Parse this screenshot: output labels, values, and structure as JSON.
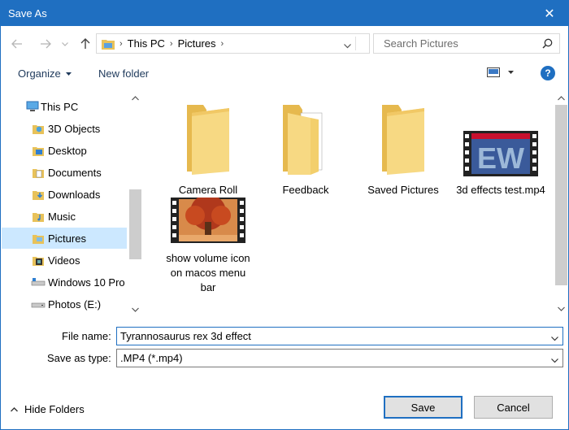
{
  "window": {
    "title": "Save As",
    "close_glyph": "✕"
  },
  "address": {
    "crumbs": [
      "This PC",
      "Pictures"
    ],
    "search_placeholder": "Search Pictures"
  },
  "toolbar": {
    "organize": "Organize",
    "new_folder": "New folder",
    "help": "?"
  },
  "sidebar": {
    "items": [
      {
        "label": "This PC",
        "icon": "computer-icon"
      },
      {
        "label": "3D Objects",
        "icon": "3d-objects-icon"
      },
      {
        "label": "Desktop",
        "icon": "desktop-icon"
      },
      {
        "label": "Documents",
        "icon": "documents-icon"
      },
      {
        "label": "Downloads",
        "icon": "downloads-icon"
      },
      {
        "label": "Music",
        "icon": "music-icon"
      },
      {
        "label": "Pictures",
        "icon": "pictures-icon",
        "selected": true
      },
      {
        "label": "Videos",
        "icon": "videos-icon"
      },
      {
        "label": "Windows 10 Pro",
        "icon": "drive-icon"
      },
      {
        "label": "Photos (E:)",
        "icon": "drive-icon"
      }
    ]
  },
  "files": [
    {
      "name": "Camera Roll",
      "kind": "folder"
    },
    {
      "name": "Feedback",
      "kind": "folder-with-docs"
    },
    {
      "name": "Saved Pictures",
      "kind": "folder"
    },
    {
      "name": "3d effects test.mp4",
      "kind": "video",
      "thumb_text": "EW"
    },
    {
      "name": "show volume icon on macos menu bar",
      "kind": "video"
    }
  ],
  "fields": {
    "file_name_label": "File name:",
    "file_name_value": "Tyrannosaurus rex 3d effect",
    "save_type_label": "Save as type:",
    "save_type_value": ".MP4 (*.mp4)"
  },
  "footer": {
    "hide_folders": "Hide Folders",
    "save": "Save",
    "cancel": "Cancel"
  },
  "colors": {
    "accent": "#1f6fc1",
    "selection": "#cce8ff",
    "folder": "#f5d57a"
  }
}
